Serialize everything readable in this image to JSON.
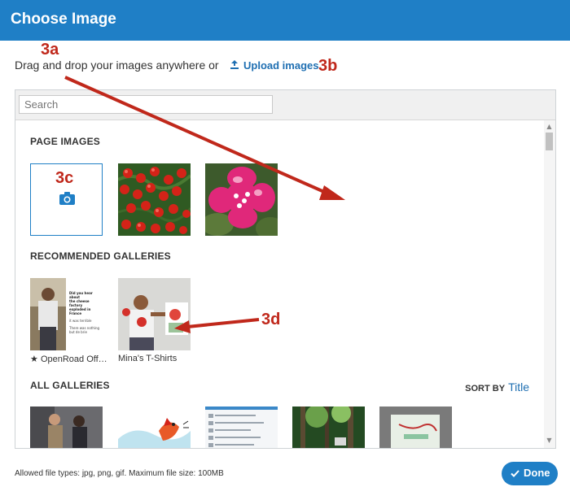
{
  "dialog": {
    "title": "Choose Image",
    "intro_text": "Drag and drop your images anywhere or",
    "upload_label": "Upload images"
  },
  "search": {
    "placeholder": "Search"
  },
  "sections": {
    "page_images": "PAGE IMAGES",
    "recommended": "RECOMMENDED GALLERIES",
    "all_galleries": "ALL GALLERIES"
  },
  "recommended_galleries": [
    {
      "caption": "OpenRoad Offi...",
      "starred": true
    },
    {
      "caption": "Mina's T-Shirts",
      "starred": false
    }
  ],
  "gallery1_thumb_text": [
    "Did you hear about",
    "the cheese factory",
    "exploded in France",
    "it was terrible",
    "There was nothing",
    "but de brie"
  ],
  "sort": {
    "label": "SORT BY",
    "value": "Title"
  },
  "footer": {
    "allowed_types": "Allowed file types: jpg, png, gif. Maximum file size: 100MB"
  },
  "done_button": {
    "label": "Done"
  },
  "annotations": {
    "a": "3a",
    "b": "3b",
    "c": "3c",
    "d": "3d"
  },
  "colors": {
    "header": "#1f7fc6",
    "accent": "#1f6fb2",
    "annotation": "#c0281b"
  },
  "icons": {
    "upload": "upload-icon",
    "camera": "camera-icon",
    "star": "star-icon",
    "check": "check-icon"
  }
}
